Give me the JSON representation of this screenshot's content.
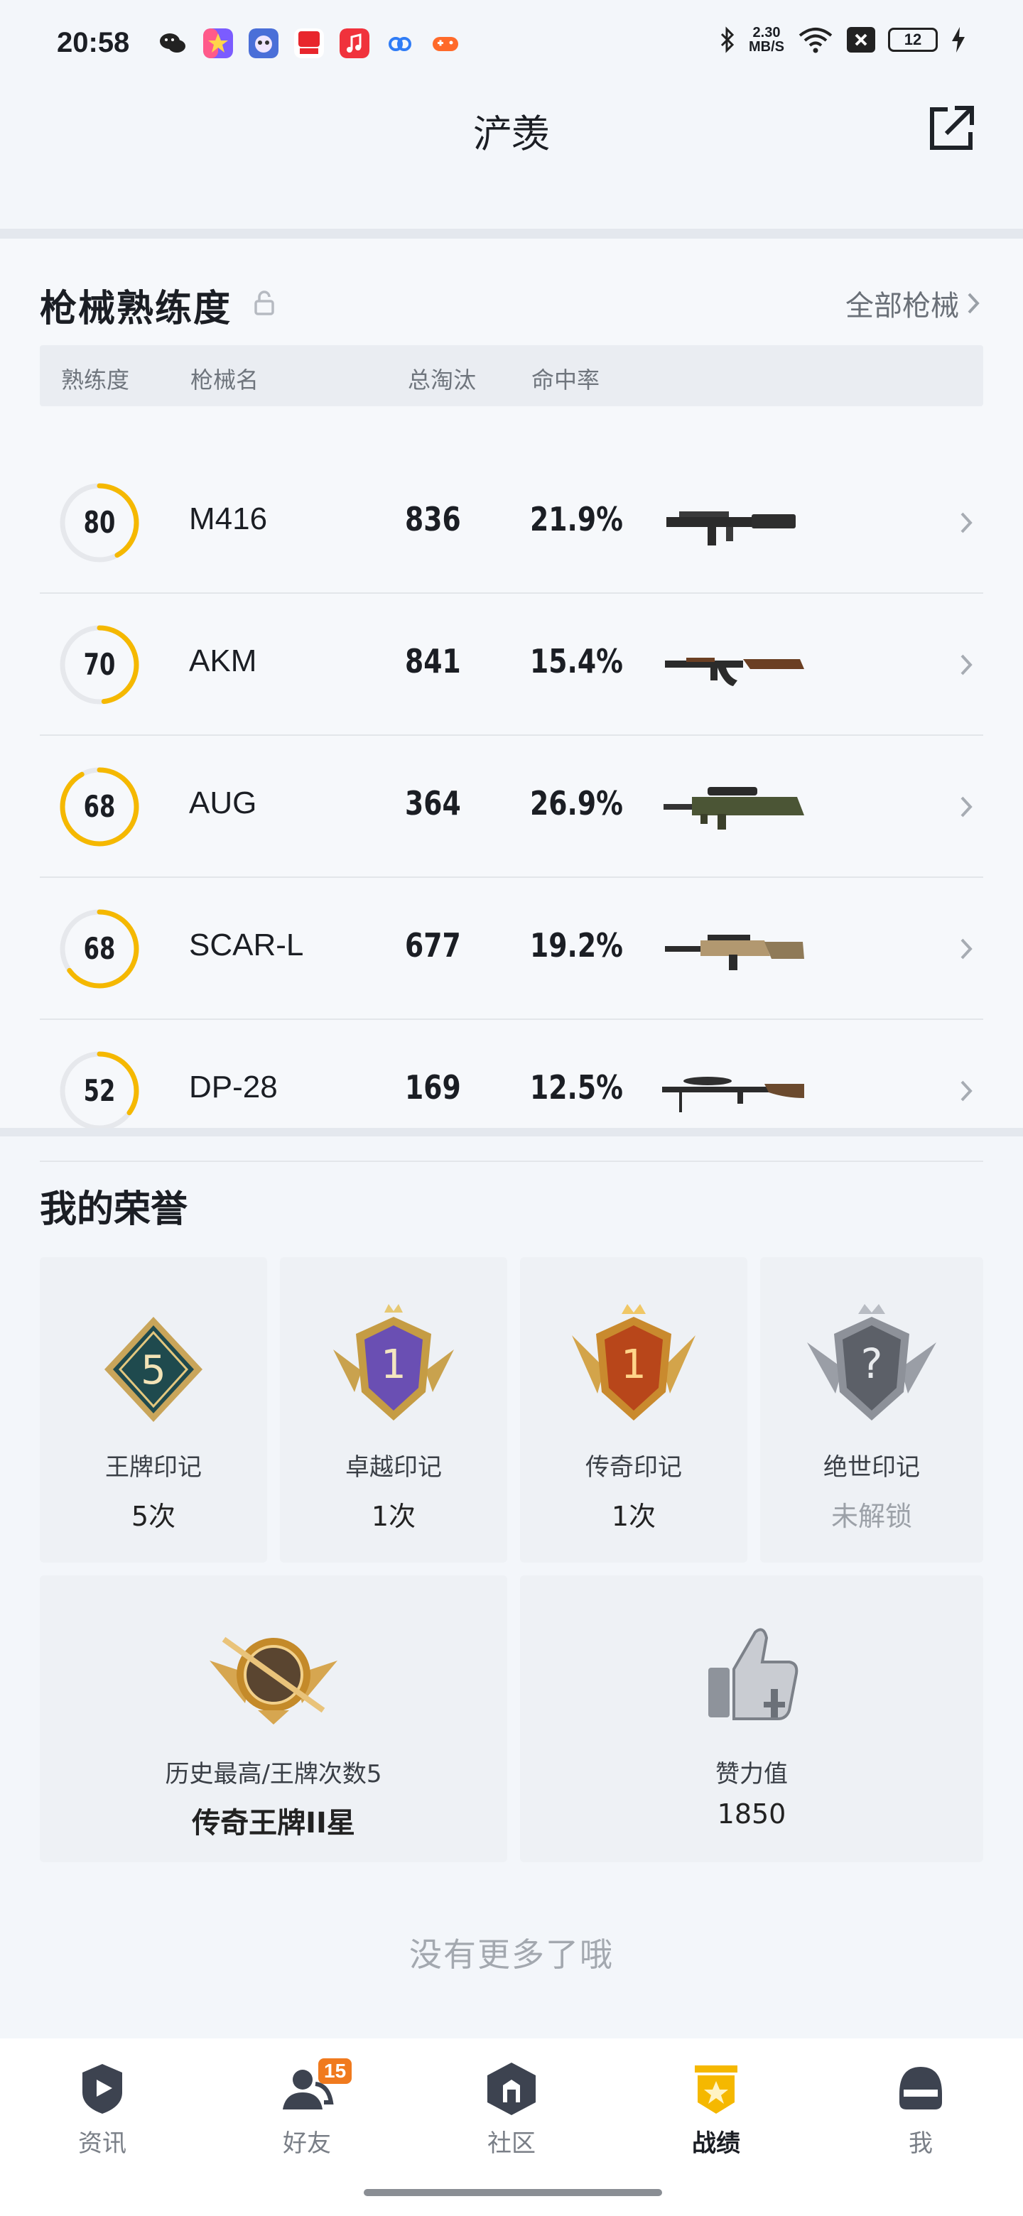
{
  "status_bar": {
    "time": "20:58",
    "net_speed_value": "2.30",
    "net_speed_unit": "MB/S",
    "battery": "12",
    "icons": [
      "wechat-icon",
      "star-app-icon",
      "game-app-icon",
      "news-app-icon",
      "music-app-icon",
      "cloud-app-icon",
      "game-controller-icon",
      "bluetooth-icon",
      "wifi-icon",
      "close-box-icon",
      "charging-icon"
    ]
  },
  "header": {
    "title": "浐羡"
  },
  "weapons": {
    "title": "枪械熟练度",
    "all_link": "全部枪械",
    "columns": [
      "熟练度",
      "枪械名",
      "总淘汰",
      "命中率"
    ],
    "rows": [
      {
        "mastery": "80",
        "name": "M416",
        "kills": "836",
        "rate": "21.9%",
        "progress": 0.42
      },
      {
        "mastery": "70",
        "name": "AKM",
        "kills": "841",
        "rate": "15.4%",
        "progress": 0.48
      },
      {
        "mastery": "68",
        "name": "AUG",
        "kills": "364",
        "rate": "26.9%",
        "progress": 0.92
      },
      {
        "mastery": "68",
        "name": "SCAR-L",
        "kills": "677",
        "rate": "19.2%",
        "progress": 0.65
      },
      {
        "mastery": "52",
        "name": "DP-28",
        "kills": "169",
        "rate": "12.5%",
        "progress": 0.35
      }
    ]
  },
  "honors": {
    "title": "我的荣誉",
    "cards": [
      {
        "name": "王牌印记",
        "value": "5次",
        "badge_number": "5"
      },
      {
        "name": "卓越印记",
        "value": "1次",
        "badge_number": "1"
      },
      {
        "name": "传奇印记",
        "value": "1次",
        "badge_number": "1"
      },
      {
        "name": "绝世印记",
        "value": "未解锁",
        "badge_number": "?"
      }
    ],
    "highest": {
      "label": "历史最高/王牌次数5",
      "value": "传奇王牌II星"
    },
    "likes": {
      "label": "赞力值",
      "value": "1850"
    }
  },
  "footer_note": "没有更多了哦",
  "nav": {
    "items": [
      {
        "label": "资讯",
        "icon": "news-icon"
      },
      {
        "label": "好友",
        "icon": "friends-icon",
        "badge": "15"
      },
      {
        "label": "社区",
        "icon": "community-icon"
      },
      {
        "label": "战绩",
        "icon": "record-icon"
      },
      {
        "label": "我",
        "icon": "profile-helmet-icon"
      }
    ],
    "active": "战绩"
  },
  "colors": {
    "accent": "#f5b800",
    "ring_track": "#e6e8ec",
    "badge_orange": "#f07a1e"
  }
}
